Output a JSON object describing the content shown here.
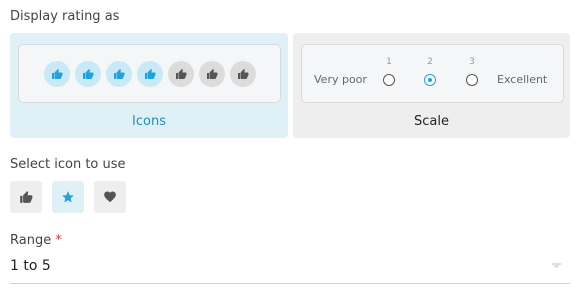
{
  "display": {
    "label": "Display rating as",
    "options": [
      {
        "name": "Icons",
        "selected": true
      },
      {
        "name": "Scale",
        "selected": false
      }
    ],
    "icons_preview": {
      "filled_count": 4,
      "total": 7
    },
    "scale_preview": {
      "low_label": "Very poor",
      "high_label": "Excellent",
      "numbers": [
        "1",
        "2",
        "3"
      ],
      "selected": "2"
    }
  },
  "icon_select": {
    "label": "Select icon to use",
    "options": [
      {
        "icon": "thumbs-up-icon",
        "selected": false
      },
      {
        "icon": "star-icon",
        "selected": true
      },
      {
        "icon": "heart-icon",
        "selected": false
      }
    ]
  },
  "range": {
    "label": "Range",
    "required_mark": "*",
    "value": "1 to 5"
  },
  "colors": {
    "accent": "#1fa3db",
    "selected_bg": "#e0f0f7",
    "unselected_bg": "#eeeeee",
    "required": "#e03c3c"
  }
}
